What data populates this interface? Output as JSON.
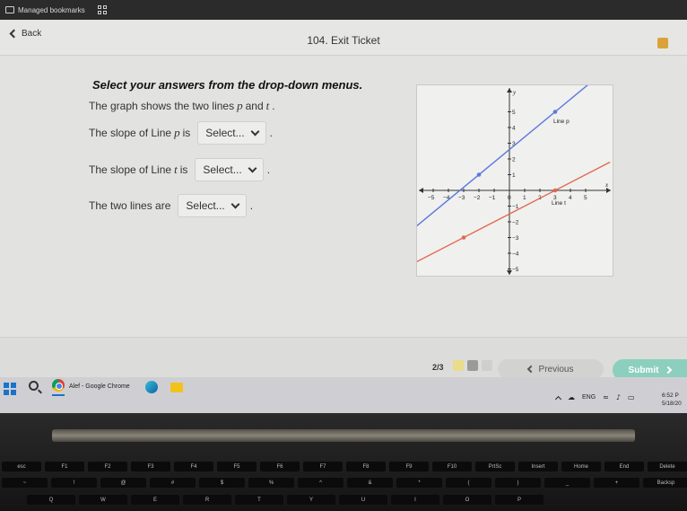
{
  "bookmarks_bar": {
    "folder_label": "Managed bookmarks"
  },
  "header": {
    "back_label": "Back",
    "title": "104. Exit Ticket"
  },
  "question": {
    "heading": "Select your answers from the drop-down menus.",
    "intro": [
      "The graph shows the two lines ",
      "p",
      " and ",
      "t",
      "."
    ],
    "q1": {
      "pre": "The slope of Line ",
      "var": "p",
      "mid": " is",
      "select": "Select...",
      "post": "."
    },
    "q2": {
      "pre": "The slope of Line ",
      "var": "t",
      "mid": "is",
      "select": "Select...",
      "post": "."
    },
    "q3": {
      "pre": "The two lines are",
      "select": "Select...",
      "post": "."
    }
  },
  "graph": {
    "axis_x_label": "x",
    "axis_y_label": "y",
    "x_ticks": [
      "−5",
      "−4",
      "−3",
      "−2",
      "−1",
      "0",
      "1",
      "2",
      "3",
      "4",
      "5"
    ],
    "y_ticks": [
      "5",
      "4",
      "3",
      "2",
      "1",
      "−1",
      "−2",
      "−3",
      "−4",
      "−5"
    ],
    "line_p": {
      "label": "Line p",
      "color": "#5b79e0",
      "points": [
        [
          -2,
          1
        ],
        [
          3,
          5
        ]
      ]
    },
    "line_t": {
      "label": "Line t",
      "color": "#e06a4e",
      "points": [
        [
          -3,
          -3
        ],
        [
          3,
          0
        ]
      ]
    }
  },
  "footer": {
    "progress": "2/3",
    "progress_colors": [
      "#e9dc8a",
      "#9a9a9a",
      "#cfcfcf"
    ],
    "previous_label": "Previous",
    "submit_label": "Submit",
    "submit_color": "#8ccfbf"
  },
  "taskbar": {
    "app_label": "Alef - Google Chrome",
    "language": "ENG",
    "time": "6:52 P",
    "date": "5/18/20"
  },
  "keyboard": {
    "row1": [
      "esc",
      "F1",
      "F2",
      "F3",
      "F4",
      "F5",
      "F6",
      "F7",
      "F8",
      "F9",
      "F10",
      "PrtSc",
      "Insert",
      "Home",
      "End",
      "Delete"
    ],
    "row2": [
      "~",
      "!",
      "@",
      "#",
      "$",
      "%",
      "^",
      "&",
      "*",
      "(",
      ")",
      "_",
      "+",
      "Backsp"
    ],
    "row3": [
      "Q",
      "W",
      "E",
      "R",
      "T",
      "Y",
      "U",
      "I",
      "O",
      "P"
    ]
  }
}
